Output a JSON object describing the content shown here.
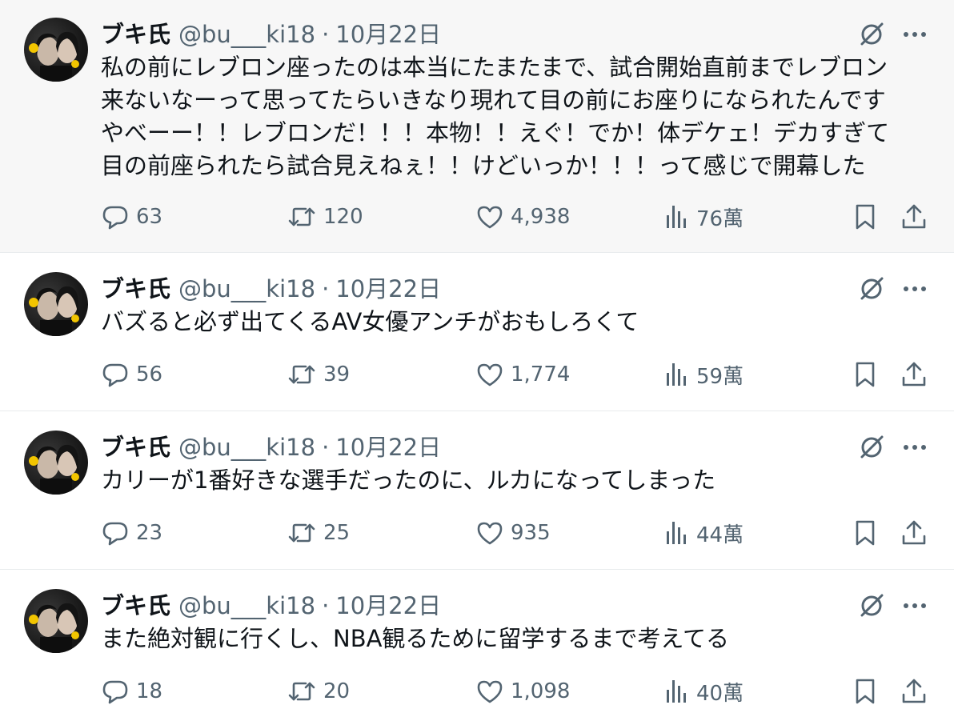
{
  "tweets": [
    {
      "name": "ブキ氏",
      "handle": "@bu___ki18",
      "separator": "·",
      "date": "10月22日",
      "text": "私の前にレブロン座ったのは本当にたまたまで、試合開始直前までレブロン\n来ないなーって思ってたらいきなり現れて目の前にお座りになられたんです\nやべーー！！レブロンだ！！！本物！！えぐ！でか！体デケェ！デカすぎて\n目の前座られたら試合見えねぇ！！けどいっか！！！って感じで開幕した",
      "replies": "63",
      "retweets": "120",
      "likes": "4,938",
      "views": "76萬"
    },
    {
      "name": "ブキ氏",
      "handle": "@bu___ki18",
      "separator": "·",
      "date": "10月22日",
      "text": "バズると必ず出てくるAV女優アンチがおもしろくて",
      "replies": "56",
      "retweets": "39",
      "likes": "1,774",
      "views": "59萬"
    },
    {
      "name": "ブキ氏",
      "handle": "@bu___ki18",
      "separator": "·",
      "date": "10月22日",
      "text": "カリーが1番好きな選手だったのに、ルカになってしまった",
      "replies": "23",
      "retweets": "25",
      "likes": "935",
      "views": "44萬"
    },
    {
      "name": "ブキ氏",
      "handle": "@bu___ki18",
      "separator": "·",
      "date": "10月22日",
      "text": "また絶対観に行くし、NBA観るために留学するまで考えてる",
      "replies": "18",
      "retweets": "20",
      "likes": "1,098",
      "views": "40萬"
    }
  ],
  "icons": {
    "reply": "speech-bubble-icon",
    "retweet": "retweet-arrows-icon",
    "like": "heart-icon",
    "views": "bar-chart-icon",
    "bookmark": "bookmark-icon",
    "share": "share-upload-icon",
    "grok": "grok-slash-circle-icon",
    "more": "ellipsis-icon"
  },
  "colors": {
    "highlight_bg": "#f7f7f7",
    "muted": "#536471",
    "text": "#0f1419"
  }
}
